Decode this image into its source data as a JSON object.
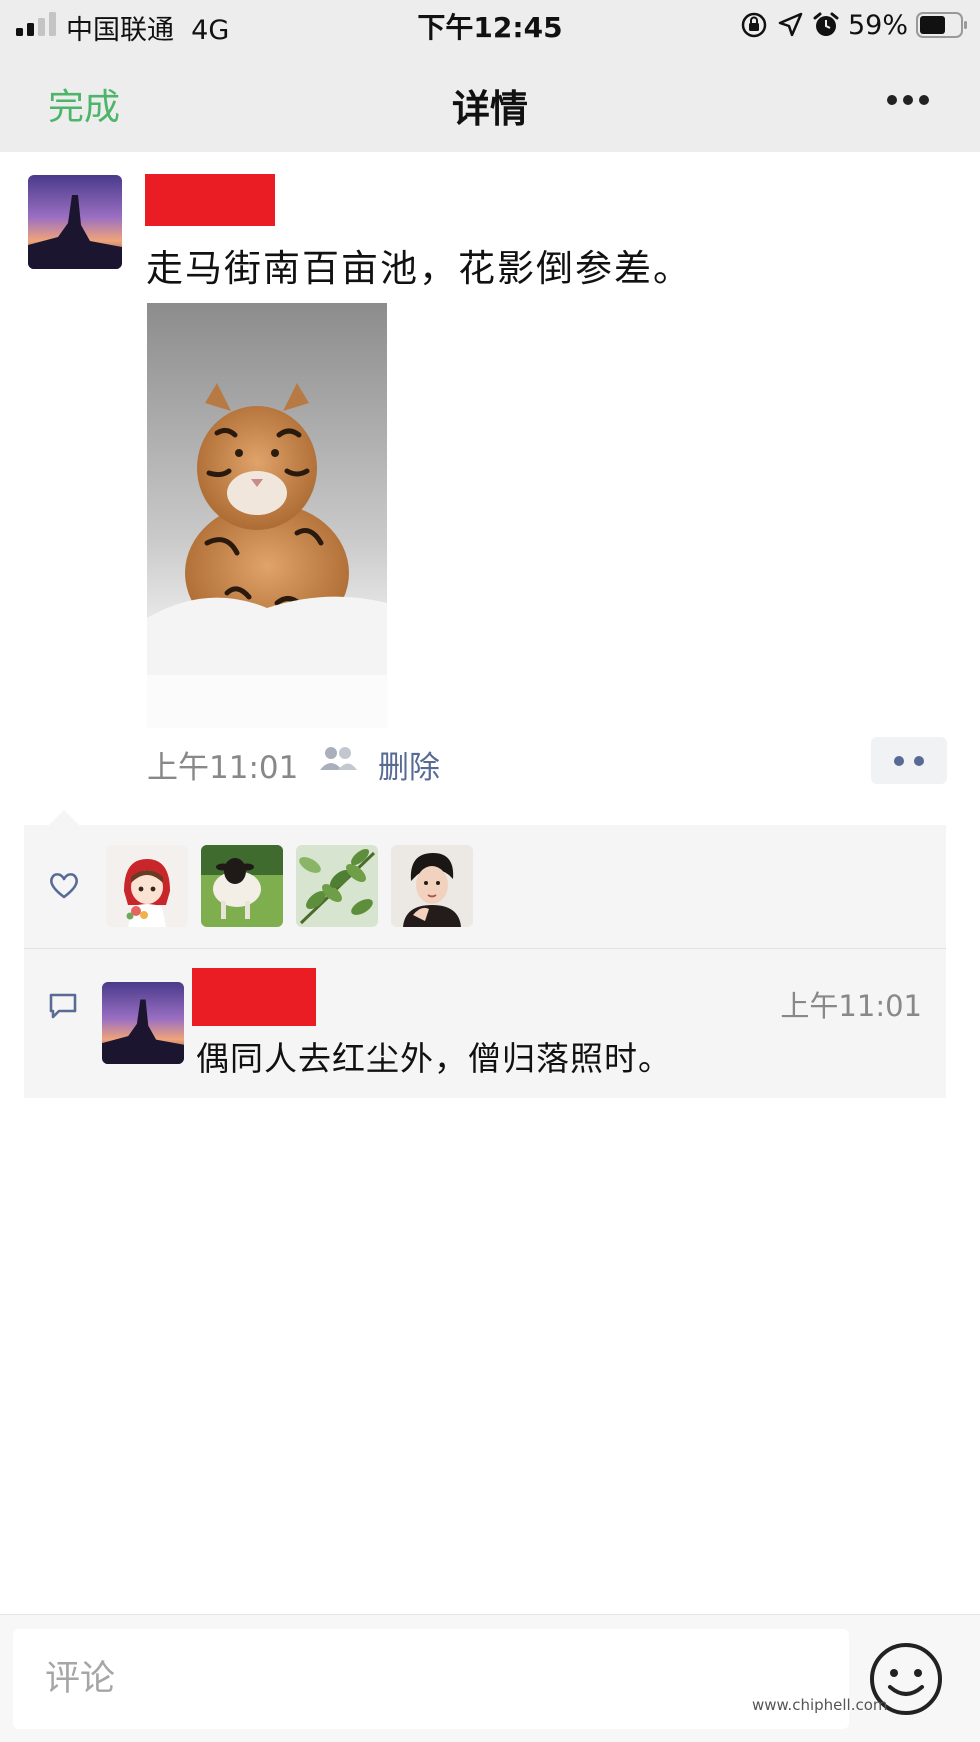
{
  "status_bar": {
    "carrier": "中国联通",
    "network": "4G",
    "time": "下午12:45",
    "battery_percent": "59%"
  },
  "nav": {
    "done_label": "完成",
    "title": "详情"
  },
  "post": {
    "text": "走马街南百亩池，花影倒参差。",
    "time": "上午11:01",
    "delete_label": "删除"
  },
  "likes": {
    "avatars": [
      "girl-avatar",
      "sheep-avatar",
      "leaves-avatar",
      "woman-avatar"
    ]
  },
  "comments": [
    {
      "time": "上午11:01",
      "text": "偶同人去红尘外，僧归落照时。"
    }
  ],
  "comment_bar": {
    "placeholder": "评论"
  },
  "watermark": "www.chiphell.com",
  "colors": {
    "accent_green": "#4db56a",
    "link_blue": "#576b95",
    "redaction": "#ea1c24"
  }
}
